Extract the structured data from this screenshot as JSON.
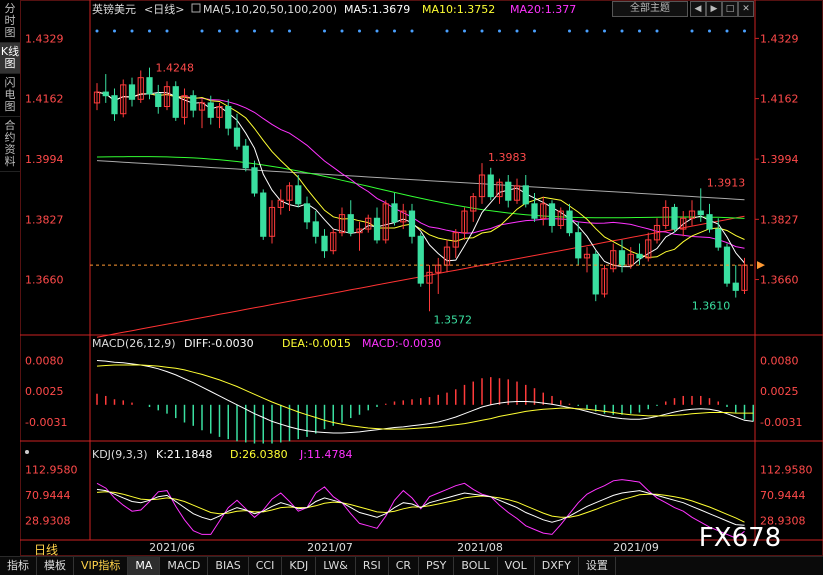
{
  "sidebar": {
    "tabs": [
      {
        "label": "分时图",
        "active": false
      },
      {
        "label": "K线图",
        "active": true
      },
      {
        "label": "闪电图",
        "active": false
      },
      {
        "label": "合约资料",
        "active": false
      }
    ]
  },
  "header": {
    "symbol": "英镑美元",
    "period": "<日线>",
    "ma_label": "MA(5,10,20,50,100,200)",
    "ma5": "MA5:1.3679",
    "ma10": "MA10:1.3752",
    "ma20": "MA20:1.377",
    "topic_button": "全部主题",
    "window_icons": [
      "left-arrow-icon",
      "right-arrow-icon",
      "maximize-icon",
      "close-icon"
    ]
  },
  "price_panel": {
    "price_ticks": [
      "1.4329",
      "1.4162",
      "1.3994",
      "1.3827",
      "1.3660"
    ],
    "annotations": [
      "1.4248",
      "1.3983",
      "1.3913",
      "1.3572",
      "1.3610"
    ]
  },
  "macd_panel": {
    "label": "MACD(26,12,9)",
    "diff": "DIFF:-0.0030",
    "dea": "DEA:-0.0015",
    "macd": "MACD:-0.0030",
    "ticks": [
      "0.0080",
      "0.0025",
      "-0.0031"
    ]
  },
  "kdj_panel": {
    "label": "KDJ(9,3,3)",
    "k": "K:21.1848",
    "d": "D:26.0380",
    "j": "J:11.4784",
    "ticks": [
      "112.9580",
      "70.9444",
      "28.9308"
    ]
  },
  "x_axis": {
    "labels": [
      "2021/06",
      "2021/07",
      "2021/08",
      "2021/09"
    ]
  },
  "watermark": "FX678",
  "period_label": "日线",
  "bottom_tabs": [
    "指标",
    "模板",
    "VIP指标",
    "MA",
    "MACD",
    "BIAS",
    "CCI",
    "KDJ",
    "LW&",
    "RSI",
    "CR",
    "PSY",
    "BOLL",
    "VOL",
    "DXFY",
    "设置"
  ],
  "colors": {
    "up": "#ff3b3b",
    "down": "#3adfa0",
    "ma5": "#ffffff",
    "ma10": "#ffff33",
    "ma20": "#ff33ff",
    "ma50": "#33ff33",
    "ma100": "#aaaaaa",
    "ma200": "#ff3333",
    "axis": "#cc2222",
    "text_red": "#ff4a4a"
  },
  "chart_data": {
    "type": "candlestick",
    "price_ylim": [
      1.352,
      1.438
    ],
    "candles": [
      [
        1.415,
        1.4205,
        1.413,
        1.418
      ],
      [
        1.418,
        1.423,
        1.415,
        1.417
      ],
      [
        1.417,
        1.419,
        1.41,
        1.412
      ],
      [
        1.412,
        1.4215,
        1.411,
        1.42
      ],
      [
        1.42,
        1.422,
        1.414,
        1.416
      ],
      [
        1.416,
        1.424,
        1.415,
        1.422
      ],
      [
        1.422,
        1.4248,
        1.416,
        1.4175
      ],
      [
        1.4175,
        1.42,
        1.412,
        1.414
      ],
      [
        1.414,
        1.421,
        1.413,
        1.4195
      ],
      [
        1.4195,
        1.421,
        1.41,
        1.411
      ],
      [
        1.411,
        1.419,
        1.409,
        1.417
      ],
      [
        1.417,
        1.4185,
        1.411,
        1.413
      ],
      [
        1.413,
        1.416,
        1.408,
        1.415
      ],
      [
        1.415,
        1.417,
        1.409,
        1.411
      ],
      [
        1.411,
        1.415,
        1.408,
        1.414
      ],
      [
        1.414,
        1.416,
        1.406,
        1.408
      ],
      [
        1.408,
        1.412,
        1.402,
        1.403
      ],
      [
        1.403,
        1.405,
        1.396,
        1.397
      ],
      [
        1.397,
        1.399,
        1.389,
        1.39
      ],
      [
        1.39,
        1.391,
        1.377,
        1.378
      ],
      [
        1.378,
        1.388,
        1.376,
        1.386
      ],
      [
        1.386,
        1.391,
        1.384,
        1.388
      ],
      [
        1.388,
        1.393,
        1.385,
        1.392
      ],
      [
        1.392,
        1.395,
        1.386,
        1.387
      ],
      [
        1.387,
        1.389,
        1.38,
        1.382
      ],
      [
        1.382,
        1.385,
        1.376,
        1.378
      ],
      [
        1.378,
        1.38,
        1.372,
        1.374
      ],
      [
        1.374,
        1.38,
        1.373,
        1.379
      ],
      [
        1.379,
        1.386,
        1.378,
        1.384
      ],
      [
        1.384,
        1.388,
        1.378,
        1.379
      ],
      [
        1.379,
        1.382,
        1.374,
        1.38
      ],
      [
        1.38,
        1.384,
        1.379,
        1.383
      ],
      [
        1.383,
        1.386,
        1.376,
        1.377
      ],
      [
        1.377,
        1.388,
        1.376,
        1.387
      ],
      [
        1.387,
        1.39,
        1.381,
        1.382
      ],
      [
        1.382,
        1.387,
        1.38,
        1.385
      ],
      [
        1.385,
        1.387,
        1.376,
        1.378
      ],
      [
        1.378,
        1.379,
        1.364,
        1.365
      ],
      [
        1.365,
        1.37,
        1.3572,
        1.368
      ],
      [
        1.368,
        1.372,
        1.362,
        1.37
      ],
      [
        1.37,
        1.377,
        1.368,
        1.375
      ],
      [
        1.375,
        1.38,
        1.372,
        1.379
      ],
      [
        1.379,
        1.386,
        1.377,
        1.385
      ],
      [
        1.385,
        1.39,
        1.382,
        1.389
      ],
      [
        1.389,
        1.3983,
        1.387,
        1.395
      ],
      [
        1.395,
        1.397,
        1.388,
        1.389
      ],
      [
        1.389,
        1.394,
        1.387,
        1.393
      ],
      [
        1.393,
        1.395,
        1.386,
        1.388
      ],
      [
        1.388,
        1.394,
        1.387,
        1.392
      ],
      [
        1.392,
        1.395,
        1.386,
        1.387
      ],
      [
        1.387,
        1.39,
        1.382,
        1.383
      ],
      [
        1.383,
        1.389,
        1.381,
        1.387
      ],
      [
        1.387,
        1.388,
        1.379,
        1.381
      ],
      [
        1.381,
        1.386,
        1.38,
        1.385
      ],
      [
        1.385,
        1.387,
        1.378,
        1.379
      ],
      [
        1.379,
        1.382,
        1.37,
        1.372
      ],
      [
        1.372,
        1.375,
        1.368,
        1.373
      ],
      [
        1.373,
        1.374,
        1.36,
        1.362
      ],
      [
        1.362,
        1.37,
        1.361,
        1.369
      ],
      [
        1.369,
        1.376,
        1.368,
        1.374
      ],
      [
        1.374,
        1.377,
        1.368,
        1.37
      ],
      [
        1.37,
        1.375,
        1.369,
        1.373
      ],
      [
        1.373,
        1.376,
        1.37,
        1.372
      ],
      [
        1.372,
        1.379,
        1.371,
        1.377
      ],
      [
        1.377,
        1.383,
        1.376,
        1.381
      ],
      [
        1.381,
        1.388,
        1.38,
        1.386
      ],
      [
        1.386,
        1.387,
        1.379,
        1.38
      ],
      [
        1.38,
        1.385,
        1.378,
        1.383
      ],
      [
        1.383,
        1.388,
        1.381,
        1.385
      ],
      [
        1.385,
        1.3913,
        1.382,
        1.384
      ],
      [
        1.384,
        1.387,
        1.379,
        1.38
      ],
      [
        1.38,
        1.383,
        1.374,
        1.375
      ],
      [
        1.375,
        1.376,
        1.364,
        1.365
      ],
      [
        1.365,
        1.37,
        1.361,
        1.363
      ],
      [
        1.363,
        1.372,
        1.362,
        1.37
      ]
    ],
    "macd": {
      "dif": [
        0.008,
        0.0079,
        0.0077,
        0.0076,
        0.0074,
        0.0072,
        0.0069,
        0.0065,
        0.006,
        0.0054,
        0.0047,
        0.004,
        0.0032,
        0.0024,
        0.0016,
        0.0008,
        0.0,
        -0.0008,
        -0.0016,
        -0.0023,
        -0.003,
        -0.0035,
        -0.004,
        -0.0044,
        -0.0047,
        -0.0049,
        -0.005,
        -0.0051,
        -0.0051,
        -0.005,
        -0.0049,
        -0.0047,
        -0.0045,
        -0.0043,
        -0.0041,
        -0.004,
        -0.0038,
        -0.0036,
        -0.0034,
        -0.0031,
        -0.0027,
        -0.0022,
        -0.0016,
        -0.001,
        -0.0004,
        0.0,
        0.0003,
        0.0005,
        0.0006,
        0.0006,
        0.0005,
        0.0003,
        0.0001,
        -0.0002,
        -0.0005,
        -0.0008,
        -0.0012,
        -0.0016,
        -0.002,
        -0.0023,
        -0.0025,
        -0.0026,
        -0.0026,
        -0.0024,
        -0.0021,
        -0.0017,
        -0.0013,
        -0.001,
        -0.0008,
        -0.0007,
        -0.0008,
        -0.0011,
        -0.0016,
        -0.0022,
        -0.0028,
        -0.003
      ],
      "dea": [
        0.007,
        0.0071,
        0.0072,
        0.0072,
        0.0072,
        0.0072,
        0.0071,
        0.007,
        0.0068,
        0.0066,
        0.0063,
        0.0059,
        0.0055,
        0.005,
        0.0045,
        0.0039,
        0.0033,
        0.0026,
        0.0019,
        0.0012,
        0.0005,
        -0.0001,
        -0.0007,
        -0.0013,
        -0.0018,
        -0.0023,
        -0.0028,
        -0.0032,
        -0.0035,
        -0.0038,
        -0.004,
        -0.0042,
        -0.0043,
        -0.0044,
        -0.0044,
        -0.0044,
        -0.0043,
        -0.0042,
        -0.0041,
        -0.004,
        -0.0038,
        -0.0036,
        -0.0034,
        -0.0031,
        -0.0028,
        -0.0025,
        -0.0021,
        -0.0018,
        -0.0015,
        -0.0012,
        -0.001,
        -0.0008,
        -0.0007,
        -0.0006,
        -0.0006,
        -0.0007,
        -0.0008,
        -0.001,
        -0.0012,
        -0.0014,
        -0.0016,
        -0.0018,
        -0.0019,
        -0.002,
        -0.002,
        -0.002,
        -0.0019,
        -0.0018,
        -0.0016,
        -0.0015,
        -0.0014,
        -0.0014,
        -0.0014,
        -0.0015,
        -0.0015,
        -0.0015
      ]
    },
    "kdj": {
      "k": [
        80,
        78,
        72,
        66,
        60,
        58,
        62,
        68,
        70,
        60,
        50,
        40,
        34,
        30,
        36,
        44,
        50,
        46,
        40,
        44,
        52,
        58,
        54,
        48,
        50,
        60,
        66,
        62,
        58,
        50,
        42,
        38,
        34,
        40,
        50,
        58,
        56,
        50,
        58,
        62,
        66,
        70,
        74,
        72,
        70,
        68,
        62,
        56,
        50,
        42,
        36,
        30,
        26,
        30,
        36,
        44,
        52,
        58,
        64,
        70,
        74,
        76,
        78,
        74,
        70,
        66,
        62,
        58,
        52,
        46,
        40,
        34,
        28,
        22,
        21
      ],
      "d": [
        75,
        76,
        75,
        72,
        68,
        64,
        63,
        64,
        66,
        64,
        60,
        54,
        48,
        42,
        40,
        41,
        44,
        45,
        43,
        43,
        46,
        50,
        51,
        50,
        50,
        53,
        57,
        59,
        58,
        55,
        51,
        47,
        43,
        42,
        44,
        48,
        51,
        51,
        53,
        56,
        59,
        62,
        66,
        68,
        69,
        68,
        66,
        63,
        59,
        53,
        47,
        41,
        36,
        34,
        34,
        37,
        42,
        47,
        53,
        58,
        63,
        67,
        71,
        72,
        72,
        70,
        68,
        65,
        61,
        56,
        51,
        45,
        39,
        33,
        26
      ]
    }
  }
}
